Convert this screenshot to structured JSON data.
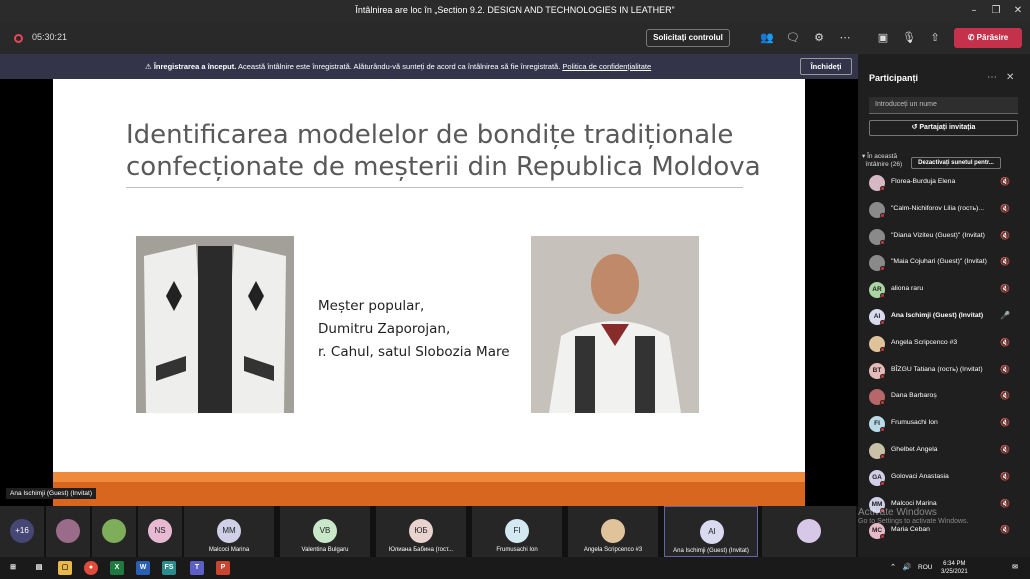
{
  "window": {
    "title": "Întâlnirea are loc în „Section 9.2. DESIGN AND TECHNOLOGIES IN LEATHER”"
  },
  "toolbar": {
    "elapsed": "05:30:21",
    "request_control": "Solicitați controlul",
    "leave": "Părăsire"
  },
  "banner": {
    "bold": "Înregistrarea a început.",
    "text": " Această întâlnire este înregistrată. Alăturându-vă sunteți de acord ca întâlnirea să fie înregistrată. ",
    "link": "Politica de confidențialitate",
    "close": "Închideți"
  },
  "slide": {
    "title": "Identificarea modelelor de bondițe tradiționale confecționate de meșterii din Republica Moldova",
    "caption_line1": "Meșter popular,",
    "caption_line2": "Dumitru Zaporojan,",
    "caption_line3": "r. Cahul, satul Slobozia Mare"
  },
  "speaker_label": "Ana Ischimji (Guest) (Invitat)",
  "panel": {
    "title": "Participanți",
    "search_placeholder": "Introduceți un nume",
    "share": "Partajați invitația",
    "section_line1": "În această",
    "section_line2": "întâlnire (26)",
    "mute_all": "Dezactivați sunetul pentr...",
    "participants": [
      {
        "initials": "",
        "name": "Florea-Burduja Elena",
        "color": "#d6b8c4",
        "mic": "off"
      },
      {
        "initials": "",
        "name": "\"Calm-Nichiforov Lilia (гость)...",
        "color": "#8a8a8a",
        "mic": "off"
      },
      {
        "initials": "",
        "name": "\"Diana Viziteu (Guest)\" (Invitat)",
        "color": "#8a8a8a",
        "mic": "off"
      },
      {
        "initials": "",
        "name": "\"Maia Cojuhari (Guest)\" (Invitat)",
        "color": "#8a8a8a",
        "mic": "off"
      },
      {
        "initials": "AR",
        "name": "aliona raru",
        "color": "#a8d5a2",
        "mic": "off"
      },
      {
        "initials": "AI",
        "name": "Ana Ischimji (Guest) (Invitat)",
        "color": "#d9d9f0",
        "mic": "on"
      },
      {
        "initials": "",
        "name": "Angela Scripcenco #3",
        "color": "#e0c39a",
        "mic": "off"
      },
      {
        "initials": "BT",
        "name": "BÎZGU Tatiana (гость) (Invitat)",
        "color": "#e8b9b9",
        "mic": "off"
      },
      {
        "initials": "",
        "name": "Dana Barbaroș",
        "color": "#b5676a",
        "mic": "off"
      },
      {
        "initials": "FI",
        "name": "Frumusachi Ion",
        "color": "#b9dbe8",
        "mic": "off"
      },
      {
        "initials": "",
        "name": "Ghelbet Angela",
        "color": "#c9c0a8",
        "mic": "off"
      },
      {
        "initials": "GA",
        "name": "Golovaci Anastasia",
        "color": "#d3cde8",
        "mic": "off"
      },
      {
        "initials": "MM",
        "name": "Malcoci Marina",
        "color": "#cfcfe8",
        "mic": "off"
      },
      {
        "initials": "MC",
        "name": "Maria Ceban",
        "color": "#e8b9c6",
        "mic": "off"
      }
    ]
  },
  "gallery": [
    {
      "initials": "+16",
      "name": "",
      "color": "#464775"
    },
    {
      "initials": "",
      "name": "",
      "color": "#9b6b8a"
    },
    {
      "initials": "",
      "name": "",
      "color": "#7fae5a"
    },
    {
      "initials": "NS",
      "name": "",
      "color": "#e8b9d2"
    },
    {
      "initials": "MM",
      "name": "Malcoci Marina",
      "color": "#cfcfe8"
    },
    {
      "initials": "VB",
      "name": "Valentina Bulgaru",
      "color": "#c9e8c9"
    },
    {
      "initials": "ЮБ",
      "name": "Юлиана Бабина (гост...",
      "color": "#e8d3cf"
    },
    {
      "initials": "FI",
      "name": "Frumusachi Ion",
      "color": "#d3e8f0"
    },
    {
      "initials": "",
      "name": "Angela Scripcenco #3",
      "color": "#e0c39a"
    },
    {
      "initials": "AI",
      "name": "Ana Ischimji (Guest) (Invitat)",
      "color": "#d9d9f0"
    },
    {
      "initials": "",
      "name": "",
      "color": "#d8c8e8"
    }
  ],
  "watermark": {
    "line1": "Activate Windows",
    "line2": "Go to Settings to activate Windows."
  },
  "taskbar": {
    "lang": "ROU",
    "time": "6:34 PM",
    "date": "3/25/2021"
  },
  "colors": {
    "leave": "#c4314b",
    "banner": "#33344a",
    "slide_band": "#d9661f",
    "record": "#e74856"
  }
}
